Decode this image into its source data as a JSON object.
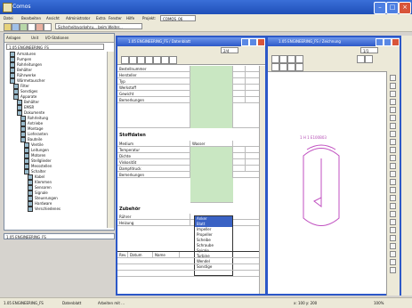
{
  "app": {
    "title": "Comos",
    "menu": [
      "Datei",
      "Bearbeiten",
      "Ansicht",
      "Administrator",
      "Extra",
      "Fenster",
      "Hilfe"
    ],
    "project_label": "Projekt:",
    "project_value": "COMOS_06",
    "toolbar_select": "Sicherheitsvorkehru... beim Weiter..."
  },
  "navigator": {
    "tabs": [
      "Anlagen",
      "Unit",
      "I/O-Stationen"
    ],
    "project_select": "1.05 ENGINEERING_FS",
    "items": [
      "Armaturen",
      "Pumpen",
      "Rohrleitungen",
      "Behälter",
      "Rührwerke",
      "Wärmetauscher",
      "Filter",
      "Sonstiges",
      "Apparate",
      "Behälter",
      "EMSR",
      "Dokumente",
      "Rohrleitung",
      "Antriebe",
      "Montage",
      "Lieferanten",
      "Bauteile",
      "Ventile",
      "Leitungen",
      "Motoren",
      "Stellglieder",
      "Messstellen",
      "Schalter",
      "Kabel",
      "Klemmen",
      "Sensoren",
      "Signale",
      "Steuerungen",
      "Hardware",
      "Verschiedenes"
    ],
    "footer": "1.05 ENGINEERING_FS"
  },
  "datasheet": {
    "title": "1.05 ENGINEERING_FS / Datenblatt",
    "page_field": "2/4",
    "section1": {
      "rows": [
        "Bestellnummer",
        "Hersteller",
        "Typ",
        "Werkstoff",
        "Gewicht",
        "Bemerkungen",
        "",
        ""
      ]
    },
    "section2_header": "Stoffdaten",
    "section2": {
      "rows": [
        "Medium",
        "Temperatur",
        "Dichte",
        "Viskosität",
        "Dampfdruck",
        "Bemerkungen"
      ],
      "value1": "Wasser"
    },
    "section3_header": "Zubehör",
    "section3": {
      "rows": [
        "Rührer",
        "Heizung"
      ]
    },
    "dropdown": {
      "selected": "Anker",
      "items": [
        "Anker",
        "Blatt",
        "Impeller",
        "Propeller",
        "Scheibe",
        "Schraube",
        "Spirale",
        "Turbine",
        "Wendel",
        "Sonstige"
      ]
    },
    "footer_cols": [
      "Rev.",
      "Datum",
      "Name"
    ]
  },
  "drawing": {
    "title": "1.05 ENGINEERING_FS / Zeichnung",
    "page_field": "1/1",
    "vessel_label": "1 H 1 E100B03"
  },
  "status": {
    "left": "1.05 ENGINEERING_FS",
    "middle": "Datenblatt",
    "right": "Arbeiten mit ...",
    "coords": "x: 100 y: 200",
    "zoom": "100%"
  }
}
